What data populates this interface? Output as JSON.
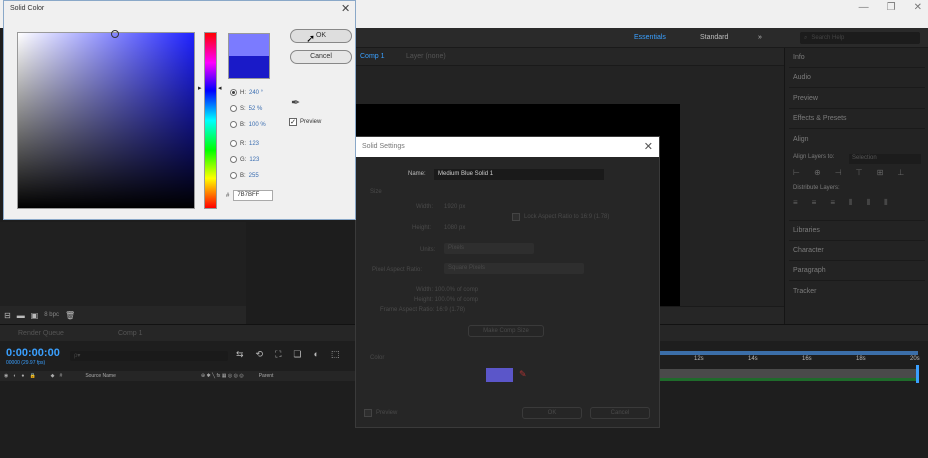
{
  "app": {
    "window_controls": [
      "—",
      "❐",
      "✕"
    ],
    "workspaces": {
      "active": "Essentials",
      "other": "Standard",
      "menu": "»"
    },
    "search_placeholder": "Search Help",
    "tl_tabs": [
      "Render Queue",
      "Comp 1"
    ],
    "comp_tabs": [
      "Comp 1",
      "Layer (none)"
    ]
  },
  "right_panel": {
    "items": [
      "Info",
      "Audio",
      "Preview",
      "Effects & Presets",
      "Align",
      "Align Layers to:",
      "Selection",
      "Distribute Layers:",
      "Libraries",
      "Character",
      "Paragraph",
      "Tracker"
    ]
  },
  "project": {
    "bpc": "8 bpc"
  },
  "timeline": {
    "time": "0:00:00:00",
    "fps": "00000 (29.97 fps)",
    "search_placeholder": "ρ▾",
    "header": [
      "Source Name",
      "Parent"
    ],
    "ruler": [
      "12s",
      "14s",
      "16s",
      "18s",
      "20s"
    ]
  },
  "solid_settings": {
    "title": "Solid Settings",
    "name_label": "Name:",
    "name_value": "Medium Blue Solid 1",
    "size_label": "Size",
    "width_label": "Width:",
    "width_value": "1920 px",
    "height_label": "Height:",
    "height_value": "1080 px",
    "lock_label": "Lock Aspect Ratio to 16:9 (1.78)",
    "units_label": "Units:",
    "units_value": "Pixels",
    "par_label": "Pixel Aspect Ratio:",
    "par_value": "Square Pixels",
    "info_width": "Width: 100.0% of comp",
    "info_height": "Height: 100.0% of comp",
    "info_frame": "Frame Aspect Ratio: 16:9 (1.78)",
    "make_comp": "Make Comp Size",
    "color_label": "Color",
    "preview_label": "Preview",
    "ok": "OK",
    "cancel": "Cancel",
    "swatch_color": "#5b56c9"
  },
  "solid_color": {
    "title": "Solid Color",
    "ok": "OK",
    "cancel": "Cancel",
    "new_color": "#7b7bff",
    "old_color": "#1a1ac8",
    "fields": [
      {
        "key": "H:",
        "value": "240 °",
        "on": true
      },
      {
        "key": "S:",
        "value": "52 %",
        "on": false
      },
      {
        "key": "B:",
        "value": "100 %",
        "on": false
      },
      {
        "key": "R:",
        "value": "123",
        "on": false
      },
      {
        "key": "G:",
        "value": "123",
        "on": false
      },
      {
        "key": "B:",
        "value": "255",
        "on": false
      }
    ],
    "hex_prefix": "#",
    "hex_value": "7B7BFF",
    "preview_label": "Preview",
    "preview_checked": "✓"
  }
}
